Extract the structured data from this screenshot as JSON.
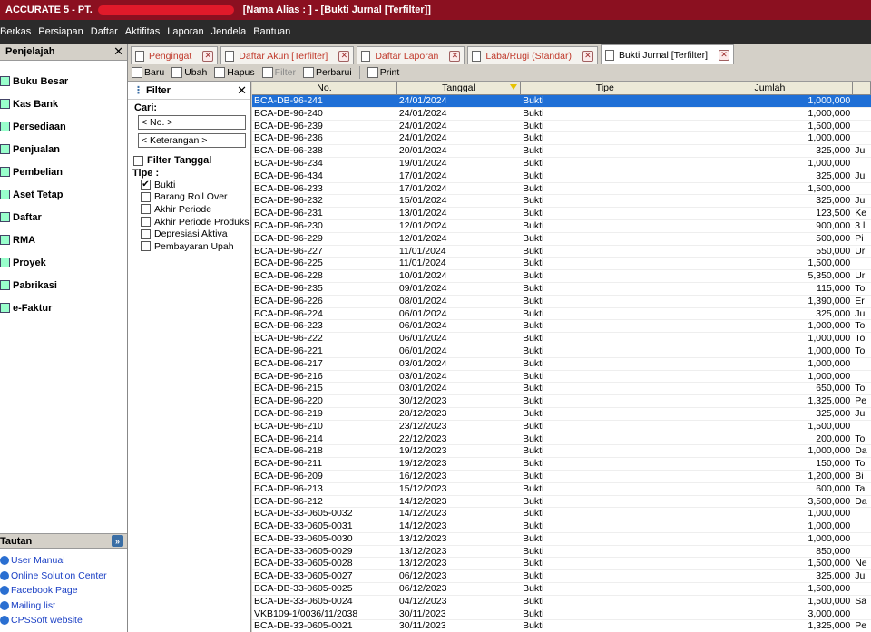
{
  "window": {
    "title_left": "ACCURATE 5 - PT.",
    "title_right": "[Nama Alias : ] - [Bukti Jurnal [Terfilter]]"
  },
  "menu": [
    "Berkas",
    "Persiapan",
    "Daftar",
    "Aktifitas",
    "Laporan",
    "Jendela",
    "Bantuan"
  ],
  "sidebar": {
    "title": "Penjelajah",
    "items": [
      "Buku Besar",
      "Kas Bank",
      "Persediaan",
      "Penjualan",
      "Pembelian",
      "Aset Tetap",
      "Daftar",
      "RMA",
      "Proyek",
      "Pabrikasi",
      "e-Faktur"
    ],
    "tautan_title": "Tautan",
    "links": [
      "User Manual",
      "Online Solution Center",
      "Facebook Page",
      "Mailing list",
      "CPSSoft website"
    ]
  },
  "tabs": [
    {
      "label": "Pengingat",
      "active": false
    },
    {
      "label": "Daftar Akun [Terfilter]",
      "active": false
    },
    {
      "label": "Daftar Laporan",
      "active": false
    },
    {
      "label": "Laba/Rugi (Standar)",
      "active": false
    },
    {
      "label": "Bukti Jurnal [Terfilter]",
      "active": true
    }
  ],
  "toolbar": {
    "baru": "Baru",
    "ubah": "Ubah",
    "hapus": "Hapus",
    "filter": "Filter",
    "perbarui": "Perbarui",
    "print": "Print"
  },
  "filter": {
    "title": "Filter",
    "cari_label": "Cari:",
    "no_placeholder": "< No. >",
    "keterangan_placeholder": "< Keterangan >",
    "filter_tanggal": "Filter Tanggal",
    "tipe_label": "Tipe :",
    "options": [
      {
        "label": "Bukti",
        "checked": true
      },
      {
        "label": "Barang Roll Over",
        "checked": false
      },
      {
        "label": "Akhir Periode",
        "checked": false
      },
      {
        "label": "Akhir Periode Produksi",
        "checked": false
      },
      {
        "label": "Depresiasi Aktiva",
        "checked": false
      },
      {
        "label": "Pembayaran Upah",
        "checked": false
      }
    ]
  },
  "grid": {
    "columns": [
      "No.",
      "Tanggal",
      "Tipe",
      "Jumlah"
    ],
    "rows": [
      [
        "BCA-DB-96-241",
        "24/01/2024",
        "Bukti",
        "1,000,000",
        ""
      ],
      [
        "BCA-DB-96-240",
        "24/01/2024",
        "Bukti",
        "1,000,000",
        ""
      ],
      [
        "BCA-DB-96-239",
        "24/01/2024",
        "Bukti",
        "1,500,000",
        ""
      ],
      [
        "BCA-DB-96-236",
        "24/01/2024",
        "Bukti",
        "1,000,000",
        ""
      ],
      [
        "BCA-DB-96-238",
        "20/01/2024",
        "Bukti",
        "325,000",
        "Ju"
      ],
      [
        "BCA-DB-96-234",
        "19/01/2024",
        "Bukti",
        "1,000,000",
        ""
      ],
      [
        "BCA-DB-96-434",
        "17/01/2024",
        "Bukti",
        "325,000",
        "Ju"
      ],
      [
        "BCA-DB-96-233",
        "17/01/2024",
        "Bukti",
        "1,500,000",
        ""
      ],
      [
        "BCA-DB-96-232",
        "15/01/2024",
        "Bukti",
        "325,000",
        "Ju"
      ],
      [
        "BCA-DB-96-231",
        "13/01/2024",
        "Bukti",
        "123,500",
        "Ke"
      ],
      [
        "BCA-DB-96-230",
        "12/01/2024",
        "Bukti",
        "900,000",
        "3 l"
      ],
      [
        "BCA-DB-96-229",
        "12/01/2024",
        "Bukti",
        "500,000",
        "Pi"
      ],
      [
        "BCA-DB-96-227",
        "11/01/2024",
        "Bukti",
        "550,000",
        "Ur"
      ],
      [
        "BCA-DB-96-225",
        "11/01/2024",
        "Bukti",
        "1,500,000",
        ""
      ],
      [
        "BCA-DB-96-228",
        "10/01/2024",
        "Bukti",
        "5,350,000",
        "Ur"
      ],
      [
        "BCA-DB-96-235",
        "09/01/2024",
        "Bukti",
        "115,000",
        "To"
      ],
      [
        "BCA-DB-96-226",
        "08/01/2024",
        "Bukti",
        "1,390,000",
        "Er"
      ],
      [
        "BCA-DB-96-224",
        "06/01/2024",
        "Bukti",
        "325,000",
        "Ju"
      ],
      [
        "BCA-DB-96-223",
        "06/01/2024",
        "Bukti",
        "1,000,000",
        "To"
      ],
      [
        "BCA-DB-96-222",
        "06/01/2024",
        "Bukti",
        "1,000,000",
        "To"
      ],
      [
        "BCA-DB-96-221",
        "06/01/2024",
        "Bukti",
        "1,000,000",
        "To"
      ],
      [
        "BCA-DB-96-217",
        "03/01/2024",
        "Bukti",
        "1,000,000",
        ""
      ],
      [
        "BCA-DB-96-216",
        "03/01/2024",
        "Bukti",
        "1,000,000",
        ""
      ],
      [
        "BCA-DB-96-215",
        "03/01/2024",
        "Bukti",
        "650,000",
        "To"
      ],
      [
        "BCA-DB-96-220",
        "30/12/2023",
        "Bukti",
        "1,325,000",
        "Pe"
      ],
      [
        "BCA-DB-96-219",
        "28/12/2023",
        "Bukti",
        "325,000",
        "Ju"
      ],
      [
        "BCA-DB-96-210",
        "23/12/2023",
        "Bukti",
        "1,500,000",
        ""
      ],
      [
        "BCA-DB-96-214",
        "22/12/2023",
        "Bukti",
        "200,000",
        "To"
      ],
      [
        "BCA-DB-96-218",
        "19/12/2023",
        "Bukti",
        "1,000,000",
        "Da"
      ],
      [
        "BCA-DB-96-211",
        "19/12/2023",
        "Bukti",
        "150,000",
        "To"
      ],
      [
        "BCA-DB-96-209",
        "16/12/2023",
        "Bukti",
        "1,200,000",
        "Bi"
      ],
      [
        "BCA-DB-96-213",
        "15/12/2023",
        "Bukti",
        "600,000",
        "Ta"
      ],
      [
        "BCA-DB-96-212",
        "14/12/2023",
        "Bukti",
        "3,500,000",
        "Da"
      ],
      [
        "BCA-DB-33-0605-0032",
        "14/12/2023",
        "Bukti",
        "1,000,000",
        ""
      ],
      [
        "BCA-DB-33-0605-0031",
        "14/12/2023",
        "Bukti",
        "1,000,000",
        ""
      ],
      [
        "BCA-DB-33-0605-0030",
        "13/12/2023",
        "Bukti",
        "1,000,000",
        ""
      ],
      [
        "BCA-DB-33-0605-0029",
        "13/12/2023",
        "Bukti",
        "850,000",
        ""
      ],
      [
        "BCA-DB-33-0605-0028",
        "13/12/2023",
        "Bukti",
        "1,500,000",
        "Ne"
      ],
      [
        "BCA-DB-33-0605-0027",
        "06/12/2023",
        "Bukti",
        "325,000",
        "Ju"
      ],
      [
        "BCA-DB-33-0605-0025",
        "06/12/2023",
        "Bukti",
        "1,500,000",
        ""
      ],
      [
        "BCA-DB-33-0605-0024",
        "04/12/2023",
        "Bukti",
        "1,500,000",
        "Sa"
      ],
      [
        "VKB109-1/0036/11/2038",
        "30/11/2023",
        "Bukti",
        "3,000,000",
        ""
      ],
      [
        "BCA-DB-33-0605-0021",
        "30/11/2023",
        "Bukti",
        "1,325,000",
        "Pe"
      ]
    ]
  },
  "colors": {
    "title_bg": "#8b1020",
    "menu_bg": "#2b2b2b",
    "selection": "#1f6fd6",
    "link": "#1a3fc4"
  }
}
